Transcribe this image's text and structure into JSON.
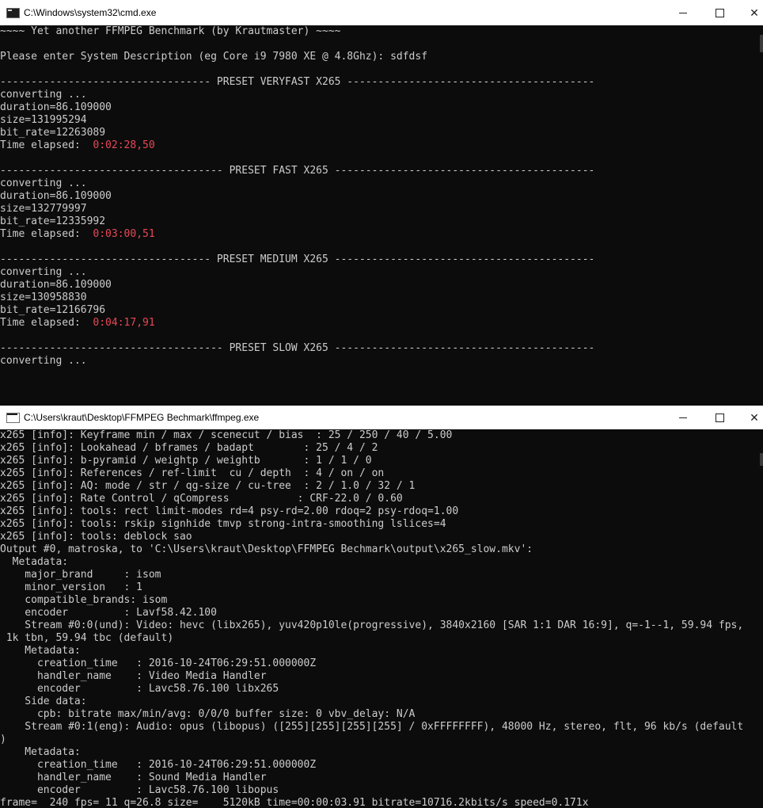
{
  "window1": {
    "title": "C:\\Windows\\system32\\cmd.exe",
    "lines": [
      {
        "text": "~~~~ Yet another FFMPEG Benchmark (by Krautmaster) ~~~~"
      },
      {
        "text": ""
      },
      {
        "text": "Please enter System Description (eg Core i9 7980 XE @ 4.8Ghz): sdfdsf"
      },
      {
        "text": ""
      },
      {
        "text": "---------------------------------- PRESET VERYFAST X265 ----------------------------------------"
      },
      {
        "text": "converting ..."
      },
      {
        "text": "duration=86.109000"
      },
      {
        "text": "size=131995294"
      },
      {
        "text": "bit_rate=12263089"
      },
      {
        "text": "Time elapsed:  ",
        "highlight": "0:02:28,50"
      },
      {
        "text": ""
      },
      {
        "text": "------------------------------------ PRESET FAST X265 ------------------------------------------"
      },
      {
        "text": "converting ..."
      },
      {
        "text": "duration=86.109000"
      },
      {
        "text": "size=132779997"
      },
      {
        "text": "bit_rate=12335992"
      },
      {
        "text": "Time elapsed:  ",
        "highlight": "0:03:00,51"
      },
      {
        "text": ""
      },
      {
        "text": "---------------------------------- PRESET MEDIUM X265 ------------------------------------------"
      },
      {
        "text": "converting ..."
      },
      {
        "text": "duration=86.109000"
      },
      {
        "text": "size=130958830"
      },
      {
        "text": "bit_rate=12166796"
      },
      {
        "text": "Time elapsed:  ",
        "highlight": "0:04:17,91"
      },
      {
        "text": ""
      },
      {
        "text": "------------------------------------ PRESET SLOW X265 ------------------------------------------"
      },
      {
        "text": "converting ..."
      }
    ]
  },
  "window2": {
    "title": "C:\\Users\\kraut\\Desktop\\FFMPEG Bechmark\\ffmpeg.exe",
    "lines": [
      {
        "text": "x265 [info]: Keyframe min / max / scenecut / bias  : 25 / 250 / 40 / 5.00"
      },
      {
        "text": "x265 [info]: Lookahead / bframes / badapt        : 25 / 4 / 2"
      },
      {
        "text": "x265 [info]: b-pyramid / weightp / weightb       : 1 / 1 / 0"
      },
      {
        "text": "x265 [info]: References / ref-limit  cu / depth  : 4 / on / on"
      },
      {
        "text": "x265 [info]: AQ: mode / str / qg-size / cu-tree  : 2 / 1.0 / 32 / 1"
      },
      {
        "text": "x265 [info]: Rate Control / qCompress           : CRF-22.0 / 0.60"
      },
      {
        "text": "x265 [info]: tools: rect limit-modes rd=4 psy-rd=2.00 rdoq=2 psy-rdoq=1.00"
      },
      {
        "text": "x265 [info]: tools: rskip signhide tmvp strong-intra-smoothing lslices=4"
      },
      {
        "text": "x265 [info]: tools: deblock sao"
      },
      {
        "text": "Output #0, matroska, to 'C:\\Users\\kraut\\Desktop\\FFMPEG Bechmark\\output\\x265_slow.mkv':"
      },
      {
        "text": "  Metadata:"
      },
      {
        "text": "    major_brand     : isom"
      },
      {
        "text": "    minor_version   : 1"
      },
      {
        "text": "    compatible_brands: isom"
      },
      {
        "text": "    encoder         : Lavf58.42.100"
      },
      {
        "text": "    Stream #0:0(und): Video: hevc (libx265), yuv420p10le(progressive), 3840x2160 [SAR 1:1 DAR 16:9], q=-1--1, 59.94 fps,"
      },
      {
        "text": " 1k tbn, 59.94 tbc (default)"
      },
      {
        "text": "    Metadata:"
      },
      {
        "text": "      creation_time   : 2016-10-24T06:29:51.000000Z"
      },
      {
        "text": "      handler_name    : Video Media Handler"
      },
      {
        "text": "      encoder         : Lavc58.76.100 libx265"
      },
      {
        "text": "    Side data:"
      },
      {
        "text": "      cpb: bitrate max/min/avg: 0/0/0 buffer size: 0 vbv_delay: N/A"
      },
      {
        "text": "    Stream #0:1(eng): Audio: opus (libopus) ([255][255][255][255] / 0xFFFFFFFF), 48000 Hz, stereo, flt, 96 kb/s (default"
      },
      {
        "text": ")"
      },
      {
        "text": "    Metadata:"
      },
      {
        "text": "      creation_time   : 2016-10-24T06:29:51.000000Z"
      },
      {
        "text": "      handler_name    : Sound Media Handler"
      },
      {
        "text": "      encoder         : Lavc58.76.100 libopus"
      },
      {
        "text": "frame=  240 fps= 11 q=26.8 size=    5120kB time=00:00:03.91 bitrate=10716.2kbits/s speed=0.171x"
      }
    ]
  },
  "colors": {
    "console_bg": "#0c0c0c",
    "console_text": "#cccccc",
    "elapsed_red": "#e74856",
    "titlebar_bg": "#ffffff"
  },
  "icons": {
    "minimize": "minimize-icon",
    "maximize": "maximize-icon",
    "close": "close-icon",
    "app": "console-app-icon"
  }
}
